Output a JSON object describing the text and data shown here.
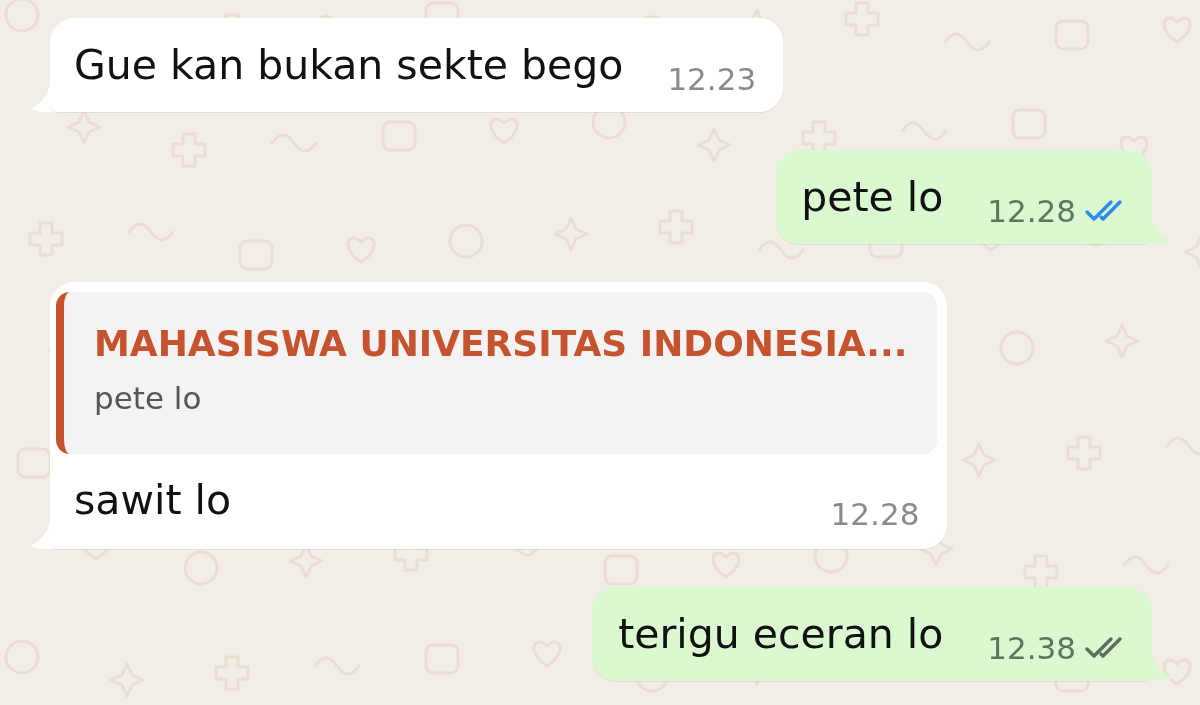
{
  "messages": [
    {
      "kind": "incoming",
      "text": "Gue kan bukan sekte bego",
      "time": "12.23"
    },
    {
      "kind": "outgoing",
      "text": "pete lo",
      "time": "12.28",
      "read": true
    },
    {
      "kind": "incoming",
      "quote": {
        "author": "MAHASISWA UNIVERSITAS INDONESIA...",
        "text": "pete lo"
      },
      "text": "sawit lo",
      "time": "12.28"
    },
    {
      "kind": "outgoing",
      "text": "terigu eceran lo",
      "time": "12.38",
      "read": false
    }
  ]
}
